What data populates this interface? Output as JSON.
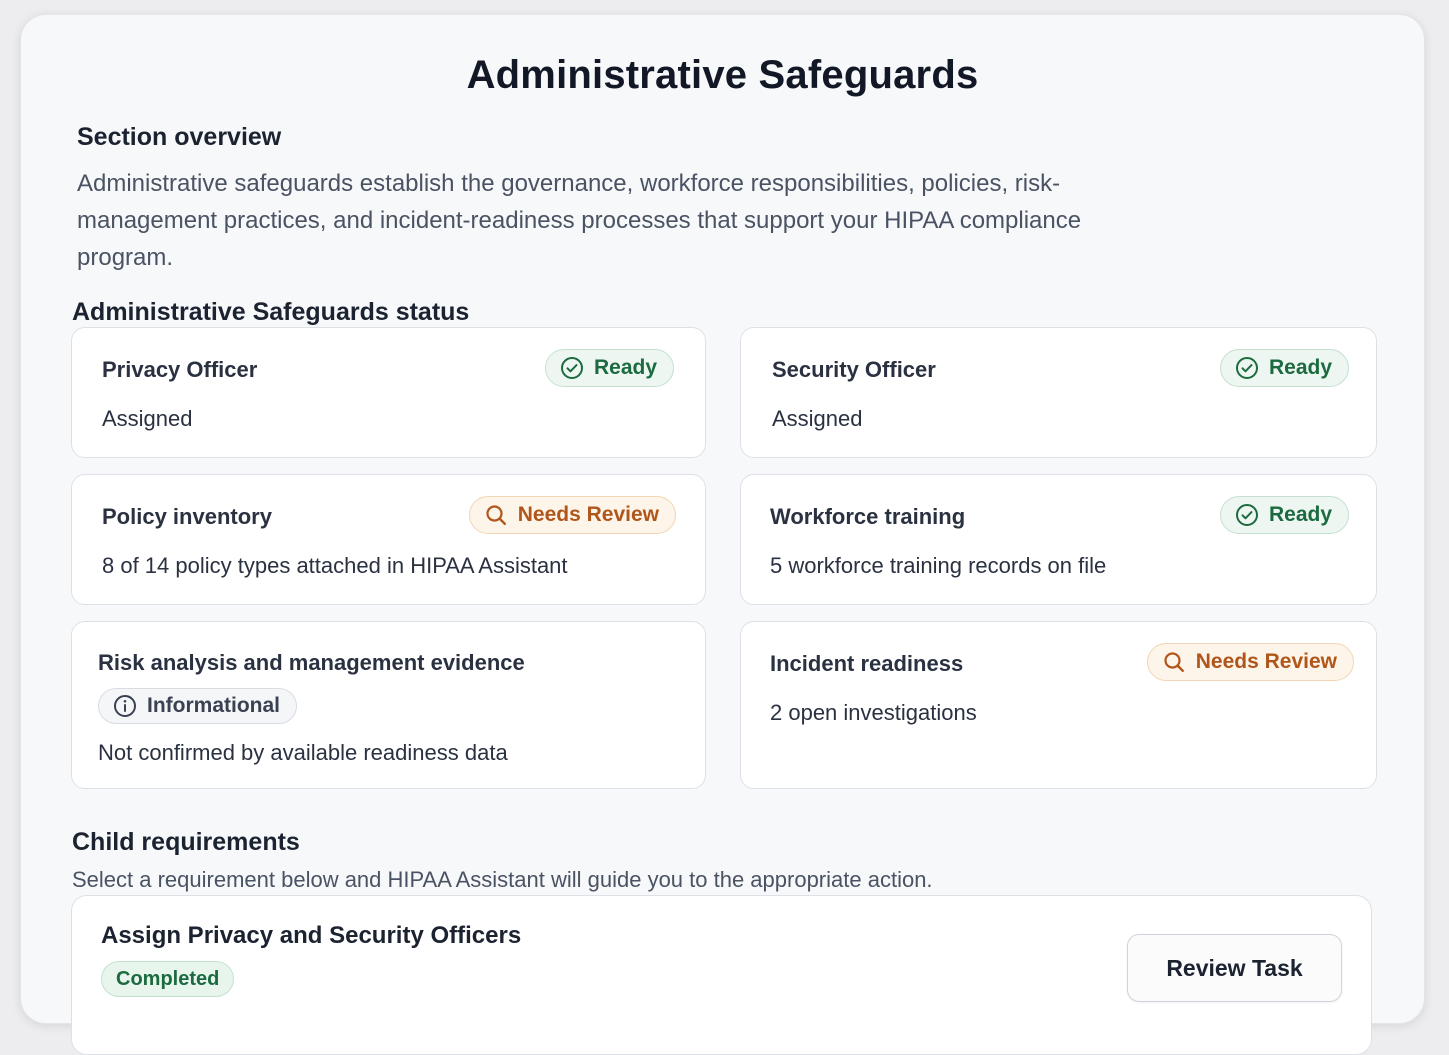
{
  "page": {
    "title": "Administrative Safeguards"
  },
  "overview": {
    "heading": "Section overview",
    "text": "Administrative safeguards establish the governance, workforce responsibilities, policies, risk-management practices, and incident-readiness processes that support your HIPAA compliance program."
  },
  "status": {
    "heading": "Administrative Safeguards status",
    "cards": [
      {
        "title": "Privacy Officer",
        "detail": "Assigned",
        "badge": "Ready",
        "badge_type": "ready"
      },
      {
        "title": "Security Officer",
        "detail": "Assigned",
        "badge": "Ready",
        "badge_type": "ready"
      },
      {
        "title": "Policy inventory",
        "detail": "8 of 14 policy types attached in HIPAA Assistant",
        "badge": "Needs Review",
        "badge_type": "review"
      },
      {
        "title": "Workforce training",
        "detail": "5 workforce training records on file",
        "badge": "Ready",
        "badge_type": "ready"
      },
      {
        "title": "Risk analysis and management evidence",
        "detail": "Not confirmed by available readiness data",
        "badge": "Informational",
        "badge_type": "info"
      },
      {
        "title": "Incident readiness",
        "detail": "2 open investigations",
        "badge": "Needs Review",
        "badge_type": "review"
      }
    ]
  },
  "child_requirements": {
    "heading": "Child requirements",
    "subtitle": "Select a requirement below and HIPAA Assistant will guide you to the appropriate action.",
    "items": [
      {
        "title": "Assign Privacy and Security Officers",
        "status": "Completed",
        "action_label": "Review Task"
      }
    ]
  },
  "colors": {
    "ready": "#1c6b40",
    "needs_review": "#b1561a",
    "informational": "#3a4252"
  },
  "icons": {
    "ready": "check-circle-icon",
    "needs_review": "search-icon",
    "informational": "info-circle-icon"
  }
}
